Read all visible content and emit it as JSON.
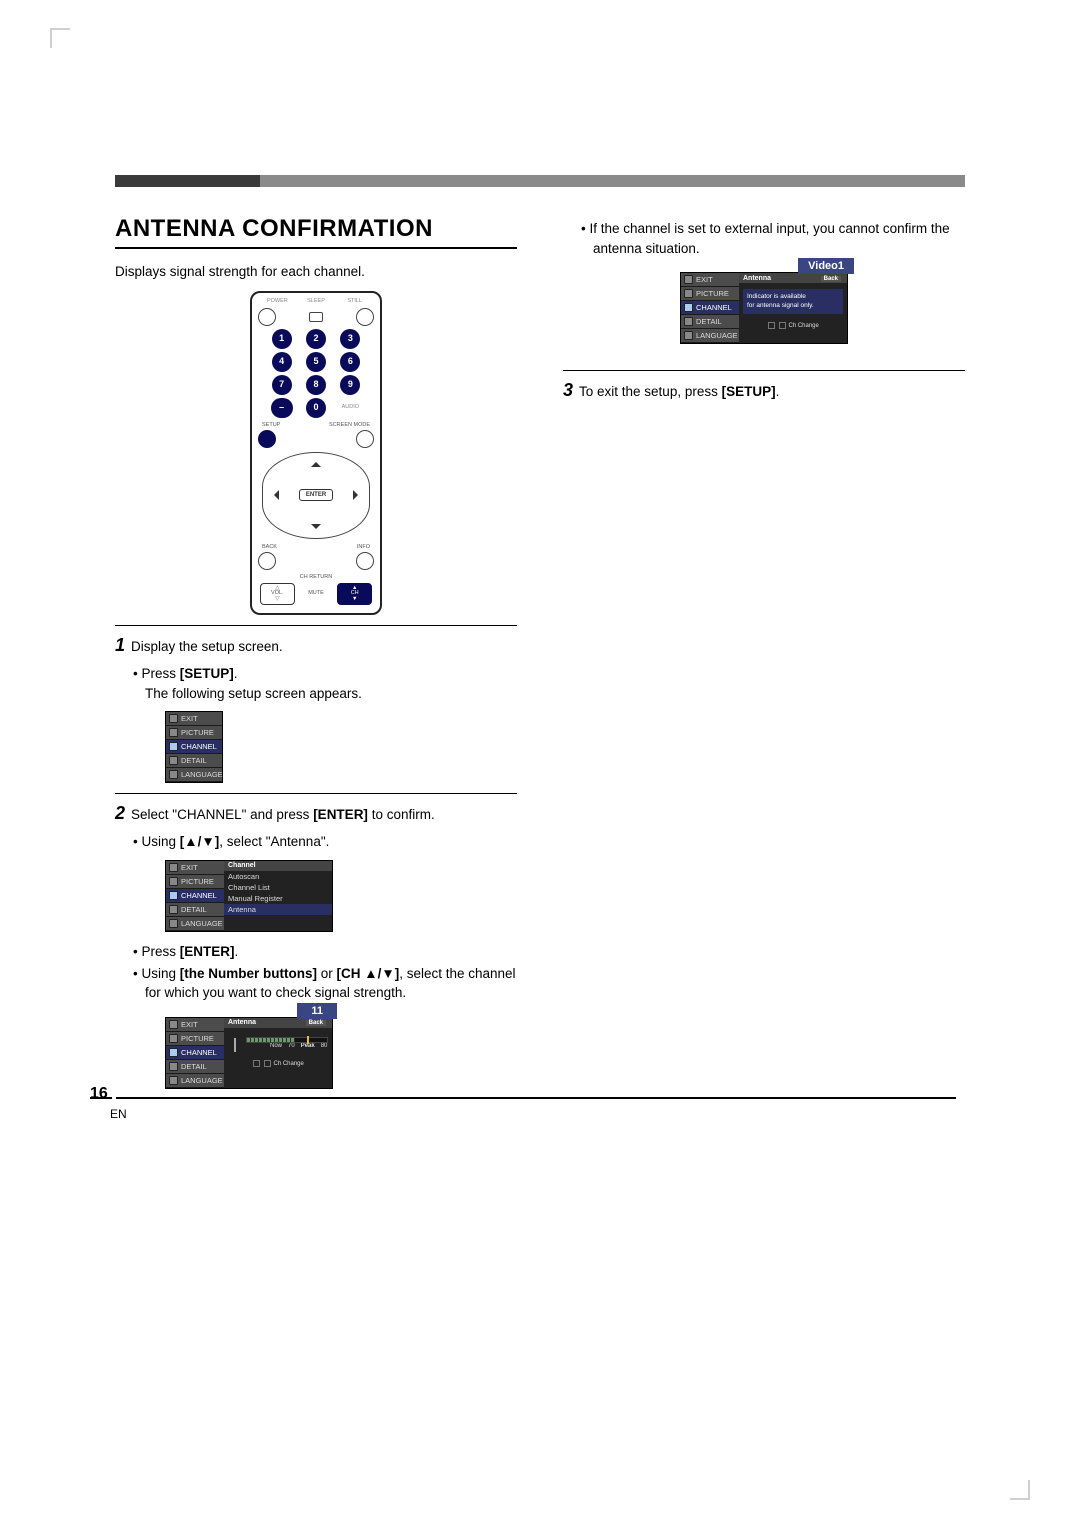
{
  "title": "ANTENNA CONFIRMATION",
  "intro": "Displays signal strength for each channel.",
  "remote": {
    "power": "POWER",
    "sleep": "SLEEP",
    "still": "STILL",
    "keys": [
      "1",
      "2",
      "3",
      "4",
      "5",
      "6",
      "7",
      "8",
      "9",
      "–",
      "0"
    ],
    "audio": "AUDIO",
    "setup": "SETUP",
    "screen_mode": "SCREEN MODE",
    "enter": "ENTER",
    "back": "BACK",
    "info": "INFO",
    "ch_return": "CH RETURN",
    "vol": "VOL.",
    "mute": "MUTE",
    "ch": "CH"
  },
  "osd_tabs": {
    "exit": "EXIT",
    "picture": "PICTURE",
    "channel": "CHANNEL",
    "detail": "DETAIL",
    "language": "LANGUAGE"
  },
  "step1": {
    "text": "Display the setup screen.",
    "b1_pre": "Press ",
    "b1_key": "[SETUP]",
    "b1_post": ".",
    "line2": "The following setup screen appears."
  },
  "step2": {
    "text_a": "Select \"CHANNEL\" and press ",
    "text_key": "[ENTER]",
    "text_b": " to confirm.",
    "b1_pre": "Using ",
    "b1_key": "[▲/▼]",
    "b1_post": ", select \"Antenna\".",
    "channel_hdr": "Channel",
    "opt_autoscan": "Autoscan",
    "opt_list": "Channel List",
    "opt_manual": "Manual Register",
    "opt_antenna": "Antenna",
    "b2_pre": "Press ",
    "b2_key": "[ENTER]",
    "b2_post": ".",
    "b3_pre": "Using ",
    "b3_key1": "[the Number buttons]",
    "b3_or": " or ",
    "b3_key2": "[CH ▲/▼]",
    "b3_post": ", select the channel for which you want to check signal strength.",
    "chip11": "11",
    "ant_hdr": "Antenna",
    "back": "Back",
    "now_lbl": "Now",
    "now_val": "70",
    "peak_lbl": "Peak",
    "peak_val": "80",
    "footer": "Ch Change"
  },
  "right": {
    "bullet": "If the channel is set to external input, you cannot confirm the antenna situation.",
    "chip_video": "Video1",
    "ant_hdr": "Antenna",
    "back": "Back",
    "msg_l1": "Indicator is available",
    "msg_l2": "for antenna signal only.",
    "footer": "Ch Change"
  },
  "step3": {
    "text_a": "To exit the setup, press ",
    "text_key": "[SETUP]",
    "text_b": "."
  },
  "page_number": "16",
  "page_locale": "EN"
}
